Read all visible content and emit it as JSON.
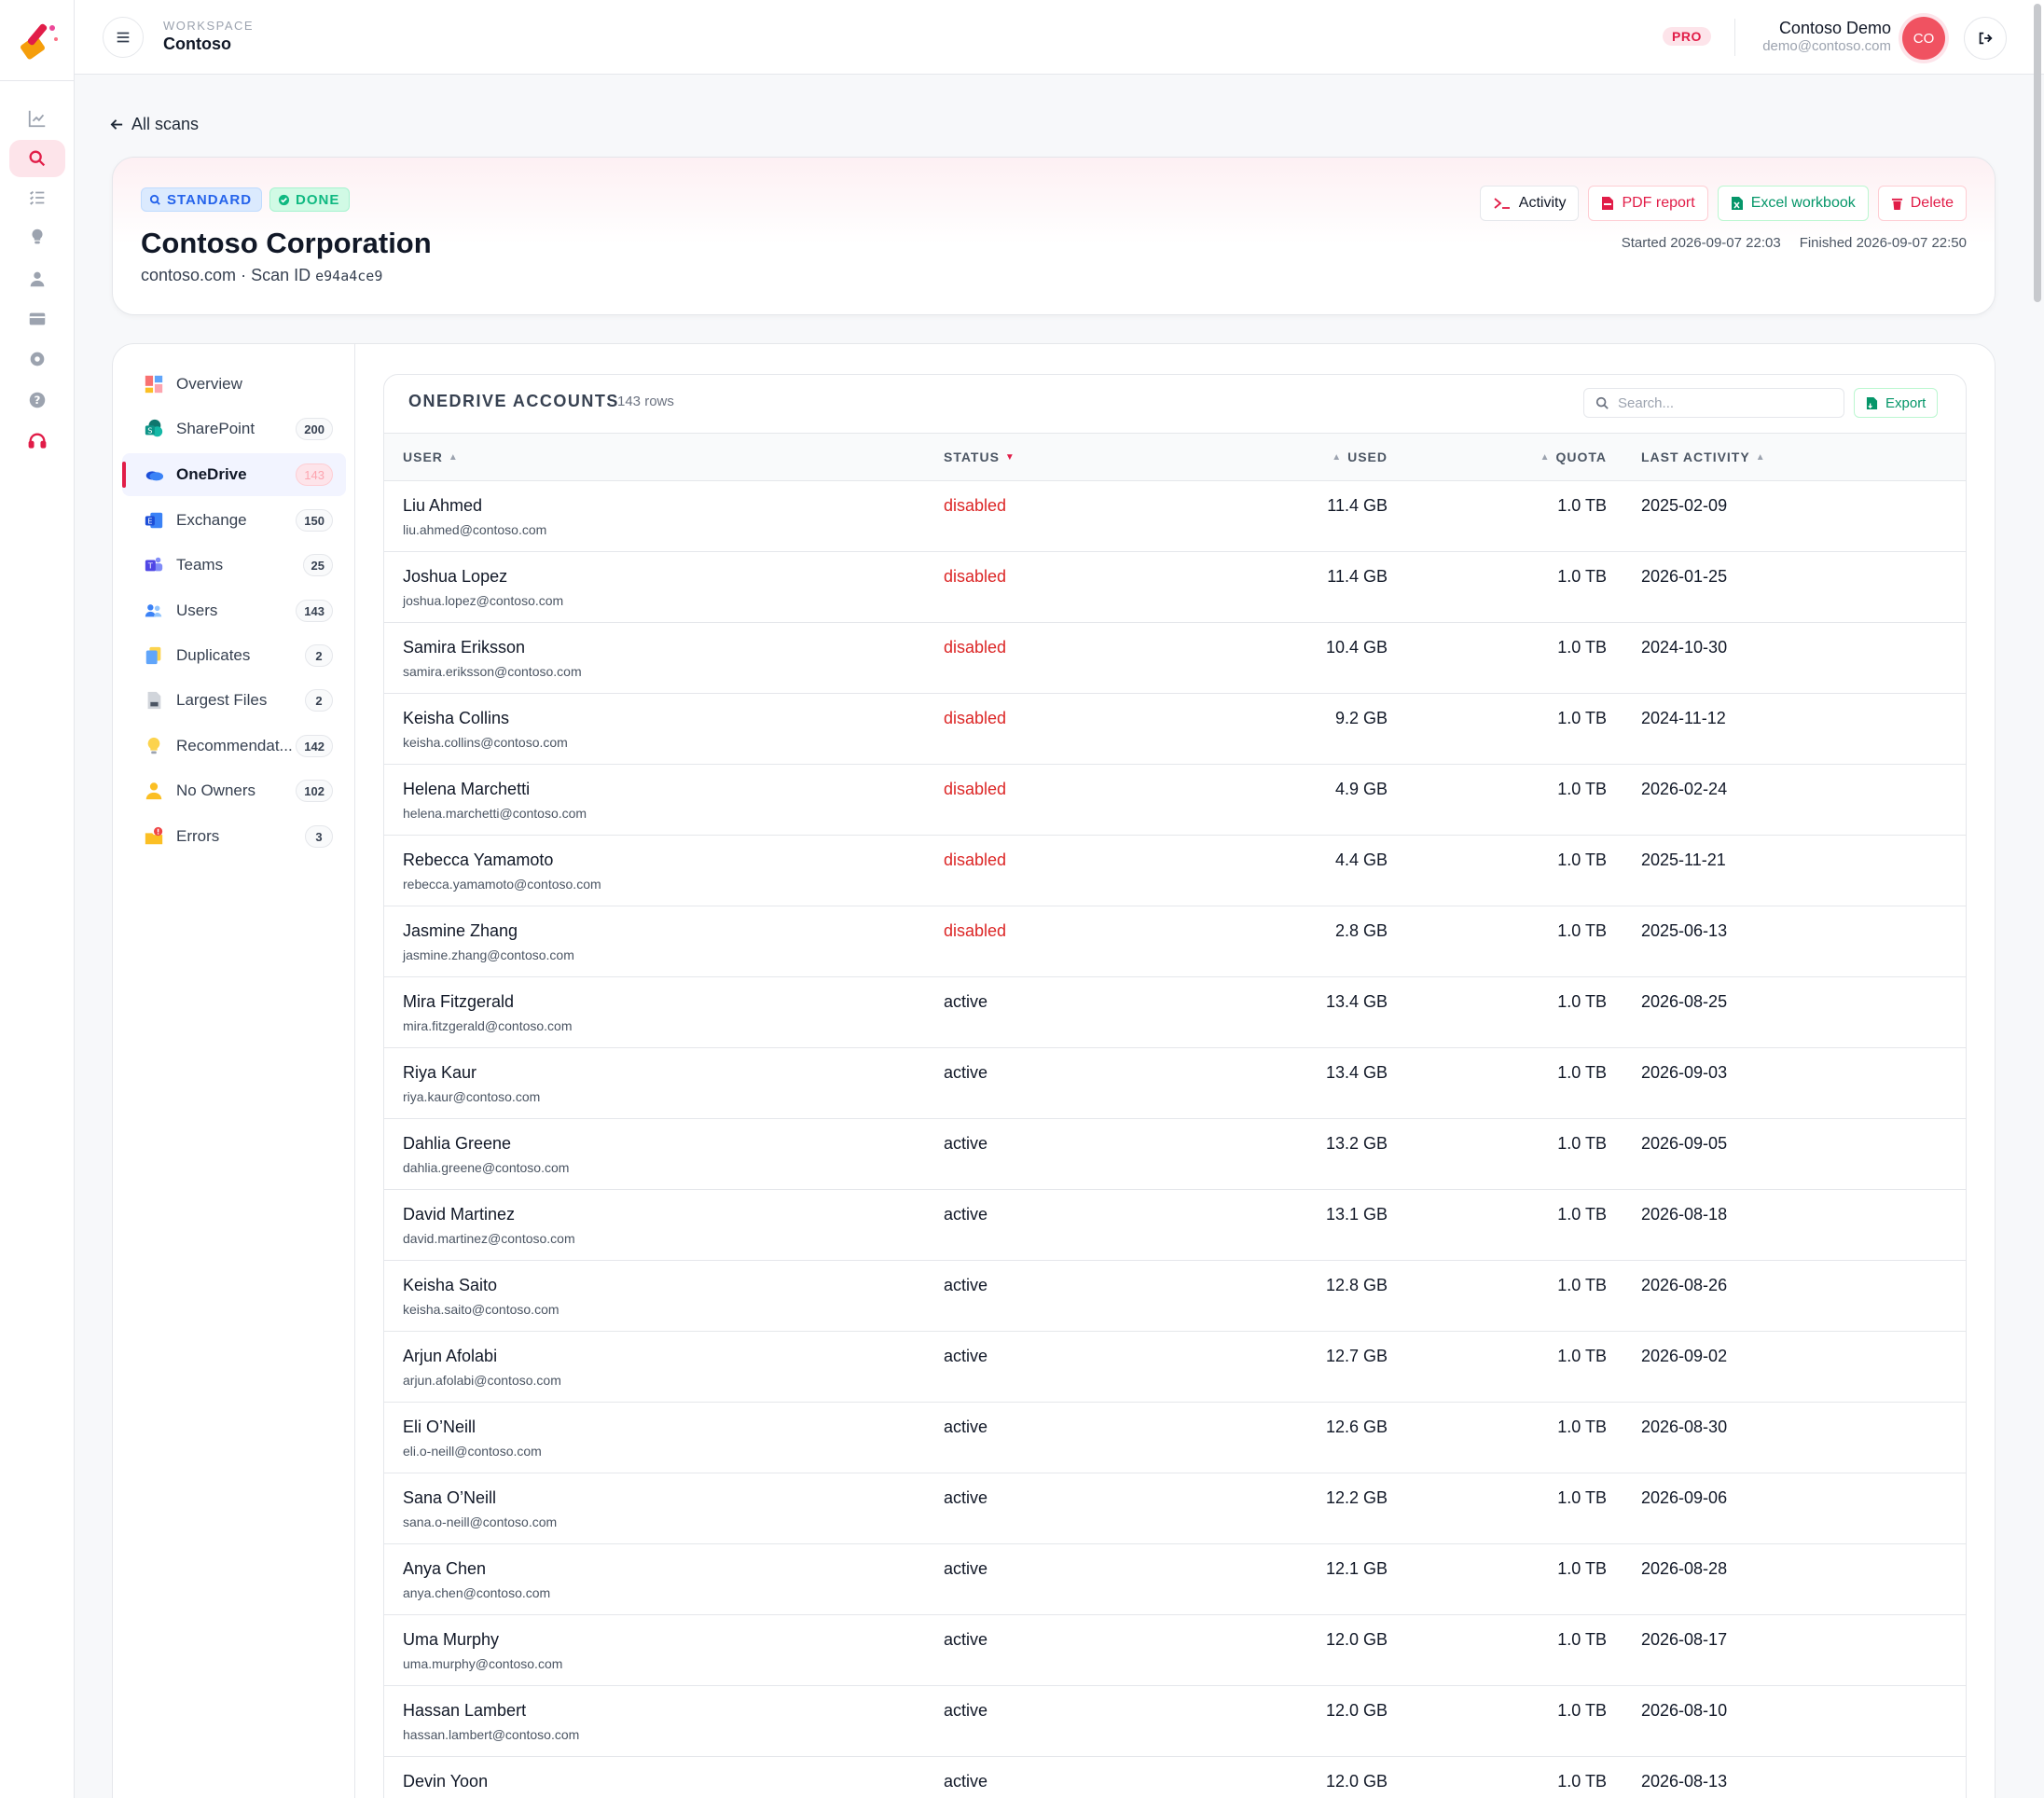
{
  "topbar": {
    "workspace_label": "WORKSPACE",
    "workspace_name": "Contoso",
    "plan_badge": "PRO",
    "user_name": "Contoso Demo",
    "user_email": "demo@contoso.com",
    "avatar_initials": "CO"
  },
  "rail": {
    "icons": [
      "chart-icon",
      "scan-search-icon",
      "checklist-icon",
      "lightbulb-icon",
      "user-icon",
      "card-icon",
      "gear-icon",
      "help-icon",
      "headset-icon"
    ],
    "active_index": 1
  },
  "back_link": "All scans",
  "scan": {
    "tag_type": "STANDARD",
    "tag_status": "DONE",
    "title": "Contoso Corporation",
    "domain": "contoso.com",
    "scan_id_label": "Scan ID",
    "scan_id": "e94a4ce9",
    "started_label": "Started",
    "started": "2026-09-07 22:03",
    "finished_label": "Finished",
    "finished": "2026-09-07 22:50",
    "actions": {
      "activity": "Activity",
      "pdf": "PDF report",
      "excel": "Excel workbook",
      "delete": "Delete"
    }
  },
  "nav": [
    {
      "label": "Overview",
      "count": "",
      "icon": "overview-icon"
    },
    {
      "label": "SharePoint",
      "count": "200",
      "icon": "sharepoint-icon"
    },
    {
      "label": "OneDrive",
      "count": "143",
      "icon": "onedrive-icon",
      "active": true
    },
    {
      "label": "Exchange",
      "count": "150",
      "icon": "exchange-icon"
    },
    {
      "label": "Teams",
      "count": "25",
      "icon": "teams-icon"
    },
    {
      "label": "Users",
      "count": "143",
      "icon": "users-icon"
    },
    {
      "label": "Duplicates",
      "count": "2",
      "icon": "duplicates-icon"
    },
    {
      "label": "Largest Files",
      "count": "2",
      "icon": "largest-files-icon"
    },
    {
      "label": "Recommendat...",
      "count": "142",
      "icon": "recommendations-icon"
    },
    {
      "label": "No Owners",
      "count": "102",
      "icon": "no-owners-icon"
    },
    {
      "label": "Errors",
      "count": "3",
      "icon": "errors-icon"
    }
  ],
  "table": {
    "title": "ONEDRIVE ACCOUNTS",
    "row_count": "143 rows",
    "search_placeholder": "Search...",
    "export_label": "Export",
    "columns": {
      "user": "USER",
      "status": "STATUS",
      "used": "USED",
      "quota": "QUOTA",
      "last_activity": "LAST ACTIVITY"
    },
    "rows": [
      {
        "name": "Liu Ahmed",
        "email": "liu.ahmed@contoso.com",
        "status": "disabled",
        "used": "11.4 GB",
        "quota": "1.0 TB",
        "last": "2025-02-09"
      },
      {
        "name": "Joshua Lopez",
        "email": "joshua.lopez@contoso.com",
        "status": "disabled",
        "used": "11.4 GB",
        "quota": "1.0 TB",
        "last": "2026-01-25"
      },
      {
        "name": "Samira Eriksson",
        "email": "samira.eriksson@contoso.com",
        "status": "disabled",
        "used": "10.4 GB",
        "quota": "1.0 TB",
        "last": "2024-10-30"
      },
      {
        "name": "Keisha Collins",
        "email": "keisha.collins@contoso.com",
        "status": "disabled",
        "used": "9.2 GB",
        "quota": "1.0 TB",
        "last": "2024-11-12"
      },
      {
        "name": "Helena Marchetti",
        "email": "helena.marchetti@contoso.com",
        "status": "disabled",
        "used": "4.9 GB",
        "quota": "1.0 TB",
        "last": "2026-02-24"
      },
      {
        "name": "Rebecca Yamamoto",
        "email": "rebecca.yamamoto@contoso.com",
        "status": "disabled",
        "used": "4.4 GB",
        "quota": "1.0 TB",
        "last": "2025-11-21"
      },
      {
        "name": "Jasmine Zhang",
        "email": "jasmine.zhang@contoso.com",
        "status": "disabled",
        "used": "2.8 GB",
        "quota": "1.0 TB",
        "last": "2025-06-13"
      },
      {
        "name": "Mira Fitzgerald",
        "email": "mira.fitzgerald@contoso.com",
        "status": "active",
        "used": "13.4 GB",
        "quota": "1.0 TB",
        "last": "2026-08-25"
      },
      {
        "name": "Riya Kaur",
        "email": "riya.kaur@contoso.com",
        "status": "active",
        "used": "13.4 GB",
        "quota": "1.0 TB",
        "last": "2026-09-03"
      },
      {
        "name": "Dahlia Greene",
        "email": "dahlia.greene@contoso.com",
        "status": "active",
        "used": "13.2 GB",
        "quota": "1.0 TB",
        "last": "2026-09-05"
      },
      {
        "name": "David Martinez",
        "email": "david.martinez@contoso.com",
        "status": "active",
        "used": "13.1 GB",
        "quota": "1.0 TB",
        "last": "2026-08-18"
      },
      {
        "name": "Keisha Saito",
        "email": "keisha.saito@contoso.com",
        "status": "active",
        "used": "12.8 GB",
        "quota": "1.0 TB",
        "last": "2026-08-26"
      },
      {
        "name": "Arjun Afolabi",
        "email": "arjun.afolabi@contoso.com",
        "status": "active",
        "used": "12.7 GB",
        "quota": "1.0 TB",
        "last": "2026-09-02"
      },
      {
        "name": "Eli O’Neill",
        "email": "eli.o-neill@contoso.com",
        "status": "active",
        "used": "12.6 GB",
        "quota": "1.0 TB",
        "last": "2026-08-30"
      },
      {
        "name": "Sana O’Neill",
        "email": "sana.o-neill@contoso.com",
        "status": "active",
        "used": "12.2 GB",
        "quota": "1.0 TB",
        "last": "2026-09-06"
      },
      {
        "name": "Anya Chen",
        "email": "anya.chen@contoso.com",
        "status": "active",
        "used": "12.1 GB",
        "quota": "1.0 TB",
        "last": "2026-08-28"
      },
      {
        "name": "Uma Murphy",
        "email": "uma.murphy@contoso.com",
        "status": "active",
        "used": "12.0 GB",
        "quota": "1.0 TB",
        "last": "2026-08-17"
      },
      {
        "name": "Hassan Lambert",
        "email": "hassan.lambert@contoso.com",
        "status": "active",
        "used": "12.0 GB",
        "quota": "1.0 TB",
        "last": "2026-08-10"
      },
      {
        "name": "Devin Yoon",
        "email": "",
        "status": "active",
        "used": "12.0 GB",
        "quota": "1.0 TB",
        "last": "2026-08-13"
      }
    ]
  },
  "colors": {
    "accent": "#e11d48",
    "status_disabled": "#dc2626",
    "success": "#059669"
  }
}
